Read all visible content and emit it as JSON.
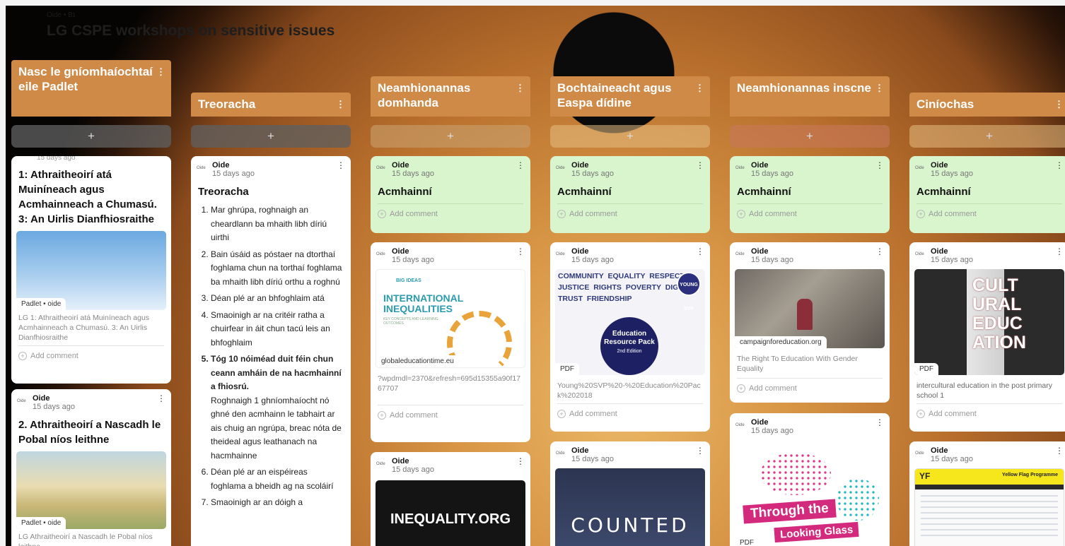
{
  "board": {
    "brand": "Oide • Bɪ",
    "title": "LG CSPE workshops on sensitive issues"
  },
  "add_symbol": "+",
  "kebab": "⋮",
  "avatar_text": "Oide",
  "columns": [
    {
      "title": "Nasc le gníomhaíochtaí eile Padlet"
    },
    {
      "title": "Treoracha"
    },
    {
      "title": "Neamhionannas domhanda"
    },
    {
      "title": "Bochtaineacht agus Easpa dídine"
    },
    {
      "title": "Neamhionannas inscne"
    },
    {
      "title": "Ciníochas"
    }
  ],
  "post_author": "Oide",
  "post_time": "15 days ago",
  "add_comment": "Add comment",
  "col1": {
    "card1_title": "1: Athraitheoirí atá Muiníneach agus Acmhainneach a Chumasú. 3: An Uirlis Dianfhiosraithe",
    "card1_tag": "Padlet • oide",
    "card1_desc": "LG 1: Athraitheoirí atá Muiníneach agus Acmhainneach a Chumasú. 3: An Uirlis Dianfhiosraithe",
    "card2_title": "2. Athraitheoirí a Nascadh le Pobal níos leithne",
    "card2_tag": "Padlet • oide",
    "card2_desc": "LG Athraitheoirí a Nascadh le Pobal níos leithne"
  },
  "col2": {
    "card_title": "Treoracha",
    "steps": [
      "Mar ghrúpa, roghnaigh an cheardlann ba mhaith libh díriú uirthi",
      "Bain úsáid as póstaer na dtorthaí foghlama chun na torthaí foghlama ba mhaith libh díriú orthu a roghnú",
      "Déan plé ar an bhfoghlaim atá",
      "Smaoinigh ar na critéir ratha a chuirfear in áit chun tacú leis an bhfoghlaim",
      "Tóg 10 nóiméad duit féin chun ceann amháin de na hacmhainní a fhiosrú.",
      "Déan plé ar an eispéireas foghlama a bheidh ag na scoláirí",
      "Smaoinigh ar an dóigh a"
    ],
    "step5_more": "Roghnaigh 1 ghníomhaíocht nó ghné den acmhainn le tabhairt ar ais chuig an ngrúpa, breac nóta de theideal agus leathanach na hacmhainne"
  },
  "resources_title": "Acmhainní",
  "col3": {
    "card2_tag": "globaleducationtime.eu",
    "card2_thumb_big": "INTERNATIONAL INEQUALITIES",
    "card2_thumb_small": "KEY CONCEPTS AND LEARNING OUTCOMES",
    "card2_thumb_logo": "BIG IDEAS",
    "card2_desc": "?wpdmdl=2370&refresh=695d15355a90f1767707",
    "card3_thumb": "INEQUALITY.ORG"
  },
  "col4": {
    "card2_tag": "PDF",
    "card2_words": "COMMUNITY EQUALITY RESPECT JUSTICE RIGHTS POVERTY DIGNITY TRUST FRIENDSHIP",
    "card2_badge": "YOUNG SVP",
    "card2_circle": "Education Resource Pack",
    "card2_edition": "2nd Edition",
    "card2_desc": "Young%20SVP%20-%20Education%20Pack%202018",
    "card3_thumb": "COUNTED"
  },
  "col5": {
    "card2_tag": "campaignforeducation.org",
    "card2_desc": "The Right To Education With Gender Equality",
    "card3_tag": "PDF",
    "card3_thumb1": "Through the",
    "card3_thumb2": "Looking Glass"
  },
  "col6": {
    "card2_tag": "PDF",
    "card2_thumb": "CULTURAL EDUCATION",
    "card2_desc": "intercultural education in the post primary school 1",
    "card3_thumb_logo": "YF",
    "card3_thumb_title": "Yellow Flag Programme"
  }
}
